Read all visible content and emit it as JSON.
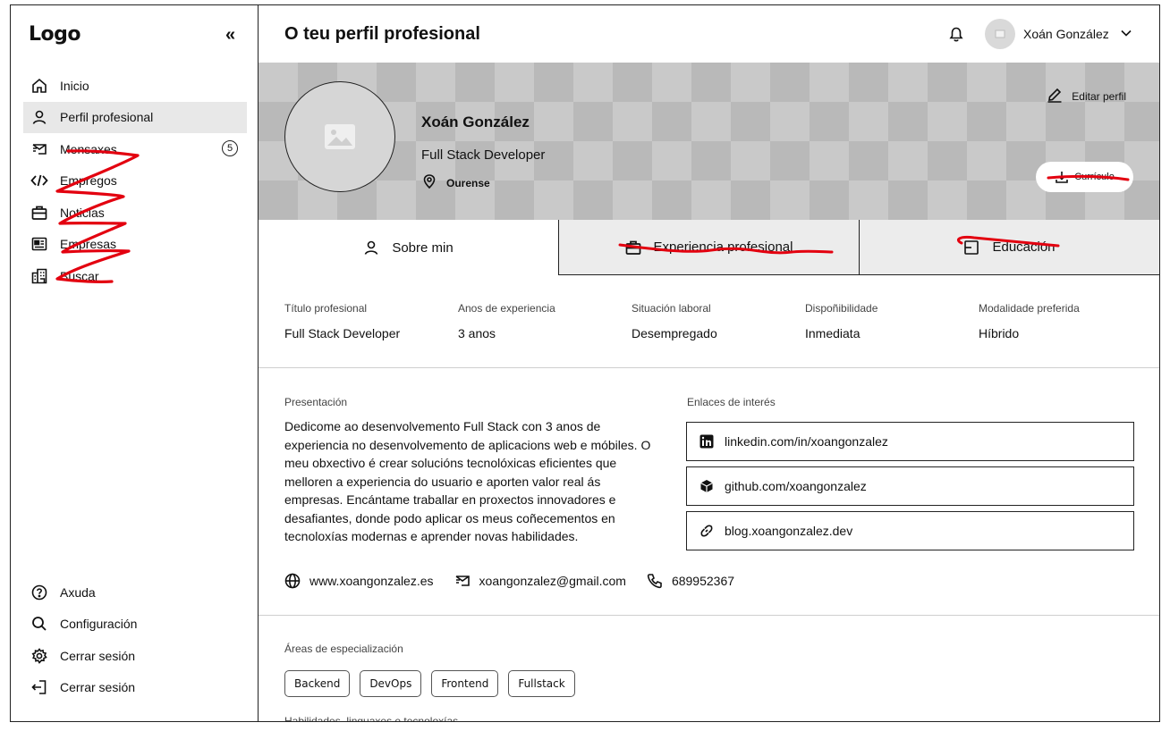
{
  "sidebar": {
    "logo": "Logo",
    "collapse_glyph": "«",
    "items": [
      {
        "label": "Inicio",
        "icon": "home-icon"
      },
      {
        "label": "Perfil profesional",
        "icon": "user-icon",
        "active": true
      },
      {
        "label": "Mensaxes",
        "icon": "mail-icon",
        "badge": "5"
      },
      {
        "label": "Empregos",
        "icon": "code-icon"
      },
      {
        "label": "Noticias",
        "icon": "briefcase-icon"
      },
      {
        "label": "Empresas",
        "icon": "newspaper-icon"
      },
      {
        "label": "Buscar",
        "icon": "building-icon"
      }
    ],
    "bottom_items": [
      {
        "label": "Axuda",
        "icon": "help-icon"
      },
      {
        "label": "Configuración",
        "icon": "search-icon"
      },
      {
        "label": "Cerrar sesión",
        "icon": "gear-icon"
      },
      {
        "label": "Cerrar sesión",
        "icon": "logout-icon"
      }
    ]
  },
  "header": {
    "title": "O teu perfil profesional",
    "user_name": "Xoán González"
  },
  "profile": {
    "name": "Xoán González",
    "role": "Full Stack Developer",
    "location": "Ourense",
    "edit_label": "Editar perfil",
    "cv_label": "Currículo"
  },
  "tabs": [
    {
      "label": "Sobre min",
      "active": true
    },
    {
      "label": "Experiencia profesional"
    },
    {
      "label": "Educación"
    }
  ],
  "info": [
    {
      "label": "Título profesional",
      "value": "Full Stack Developer"
    },
    {
      "label": "Anos de experiencia",
      "value": "3 anos"
    },
    {
      "label": "Situación laboral",
      "value": "Desempregado"
    },
    {
      "label": "Dispoñibilidade",
      "value": "Inmediata"
    },
    {
      "label": "Modalidade preferida",
      "value": "Híbrido"
    }
  ],
  "presentation": {
    "label": "Presentación",
    "text": "Dedicome ao desenvolvemento Full Stack con 3 anos de experiencia no desenvolvemento de aplicacions web e móbiles. O meu obxectivo é crear solucións tecnolóxicas eficientes que melloren a experiencia do usuario e aporten valor real ás empresas. Encántame traballar en proxectos innovadores e desafiantes, donde podo aplicar os meus coñecementos en tecnoloxías modernas e aprender novas habilidades."
  },
  "links": {
    "label": "Enlaces de interés",
    "items": [
      {
        "text": "linkedin.com/in/xoangonzalez",
        "icon": "linkedin-icon"
      },
      {
        "text": "github.com/xoangonzalez",
        "icon": "github-icon"
      },
      {
        "text": "blog.xoangonzalez.dev",
        "icon": "link-icon"
      }
    ]
  },
  "contact": {
    "website": "www.xoangonzalez.es",
    "email": "xoangonzalez@gmail.com",
    "phone": "689952367"
  },
  "areas": {
    "label": "Áreas de especialización",
    "chips": [
      "Backend",
      "DevOps",
      "Frontend",
      "Fullstack"
    ]
  },
  "skills_label": "Habilidades, linguaxes e tecnoloxías",
  "colors": {
    "scribble": "#e3000f",
    "banner_light": "#c9c9c9",
    "banner_dark": "#b9b9b9",
    "active_nav": "#e8e8e8"
  }
}
